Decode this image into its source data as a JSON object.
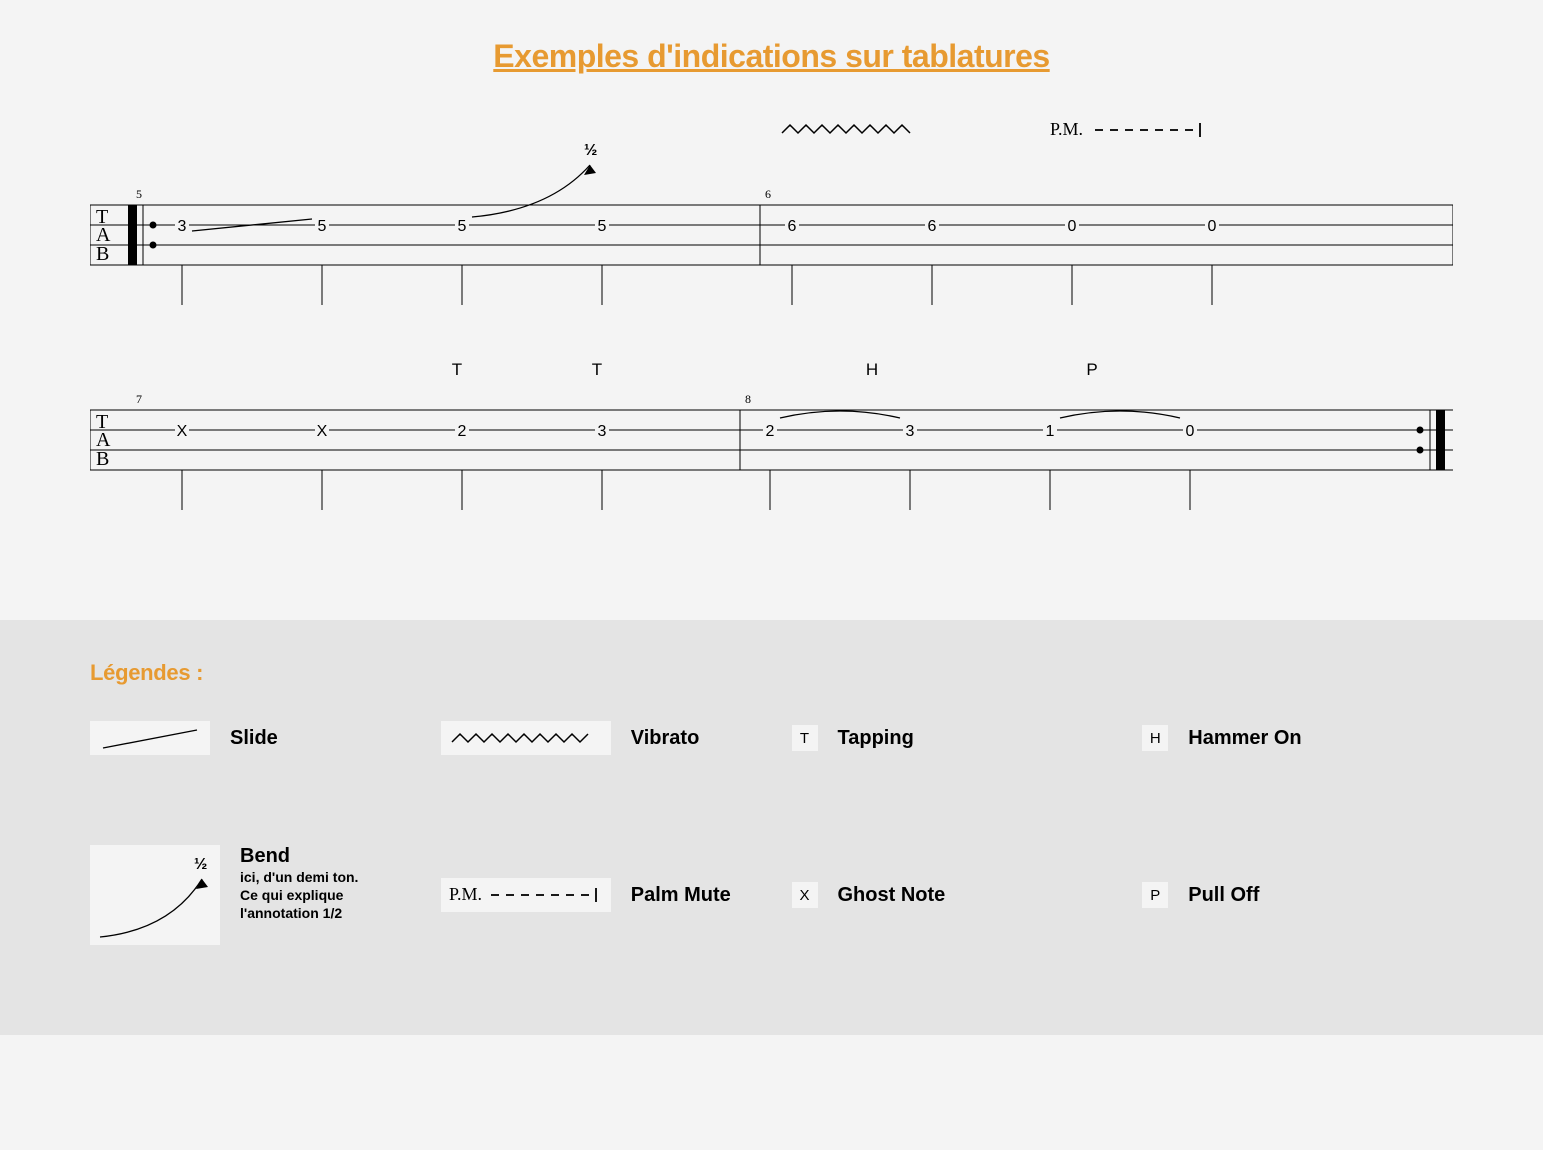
{
  "title": "Exemples d'indications sur tablatures",
  "tab_label": {
    "t": "T",
    "a": "A",
    "b": "B"
  },
  "bars": [
    {
      "num": "5",
      "notes": [
        "3",
        "5",
        "5",
        "5"
      ]
    },
    {
      "num": "6",
      "notes": [
        "6",
        "6",
        "0",
        "0"
      ]
    },
    {
      "num": "7",
      "notes": [
        "X",
        "X",
        "2",
        "3"
      ]
    },
    {
      "num": "8",
      "notes": [
        "2",
        "3",
        "1",
        "0"
      ]
    }
  ],
  "annotations": {
    "bend_fraction": "½",
    "pm_label": "P.M.",
    "t1": "T",
    "t2": "T",
    "h": "H",
    "p": "P"
  },
  "legend": {
    "heading": "Légendes :",
    "slide": "Slide",
    "vibrato": "Vibrato",
    "tapping": "Tapping",
    "hammer": "Hammer On",
    "bend": "Bend",
    "bend_sub1": "ici, d'un demi ton.",
    "bend_sub2": "Ce qui explique",
    "bend_sub3": "l'annotation 1/2",
    "palm": "Palm Mute",
    "ghost": "Ghost Note",
    "pull": "Pull Off",
    "badge_t": "T",
    "badge_h": "H",
    "badge_x": "X",
    "badge_p": "P",
    "pm": "P.M.",
    "bend_fraction": "½"
  }
}
